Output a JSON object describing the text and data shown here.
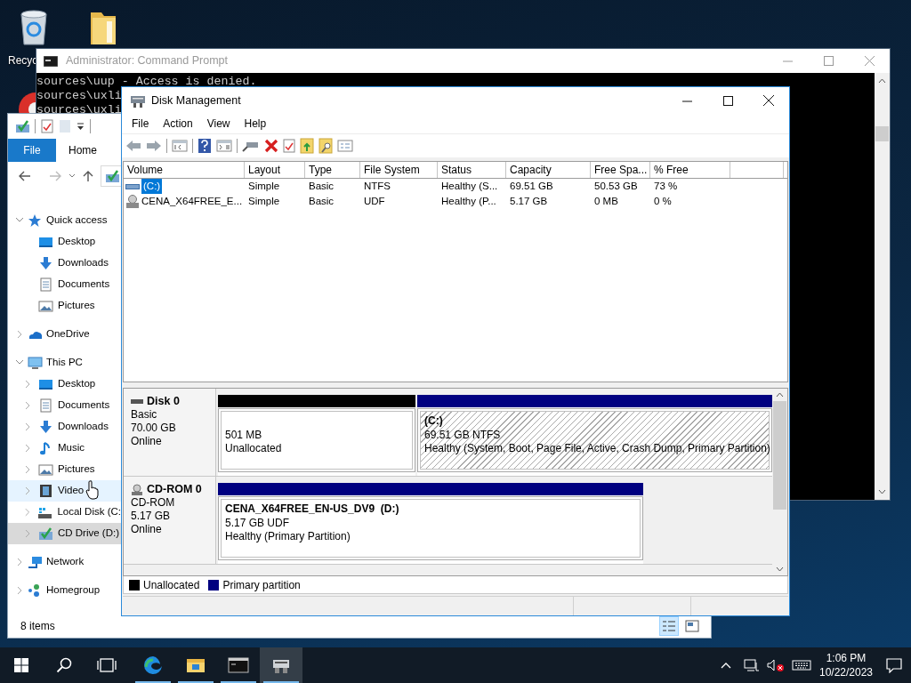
{
  "desktop_icons": [
    {
      "kind": "recycle_bin",
      "label": "Recyc"
    },
    {
      "kind": "folder"
    }
  ],
  "command_prompt": {
    "title": "Administrator: Command Prompt",
    "active": false,
    "lines": [
      "sources\\uup - Access is denied.",
      "sources\\uxli",
      "sources\\uxli"
    ]
  },
  "explorer": {
    "ribbon_tabs": [
      {
        "label": "File",
        "kind": "menu"
      },
      {
        "label": "Home",
        "kind": "tab"
      }
    ],
    "tree": [
      {
        "kind": "quick_access",
        "label": "Quick access",
        "expanded": true,
        "selected": false,
        "hover": false,
        "children": [
          {
            "kind": "desktop",
            "label": "Desktop",
            "selected": false,
            "hover": false
          },
          {
            "kind": "downloads",
            "label": "Downloads",
            "selected": false,
            "hover": false
          },
          {
            "kind": "documents",
            "label": "Documents",
            "selected": false,
            "hover": false
          },
          {
            "kind": "pictures",
            "label": "Pictures",
            "selected": false,
            "hover": false
          }
        ]
      },
      {
        "kind": "onedrive",
        "label": "OneDrive",
        "expanded": false,
        "selected": false,
        "hover": false
      },
      {
        "kind": "pc",
        "label": "This PC",
        "expanded": true,
        "selected": false,
        "hover": false,
        "children": [
          {
            "kind": "desktop",
            "label": "Desktop",
            "expanded": false,
            "selected": false,
            "hover": false
          },
          {
            "kind": "documents",
            "label": "Documents",
            "expanded": false,
            "selected": false,
            "hover": false
          },
          {
            "kind": "downloads",
            "label": "Downloads",
            "expanded": false,
            "selected": false,
            "hover": false
          },
          {
            "kind": "music",
            "label": "Music",
            "expanded": false,
            "selected": false,
            "hover": false
          },
          {
            "kind": "pictures",
            "label": "Pictures",
            "expanded": false,
            "selected": false,
            "hover": false
          },
          {
            "kind": "videos",
            "label": "Video",
            "expanded": false,
            "selected": false,
            "hover": true
          },
          {
            "kind": "local_disk",
            "label": "Local Disk (C:",
            "expanded": false,
            "selected": false,
            "hover": false
          },
          {
            "kind": "cd",
            "label": "CD Drive (D:)",
            "expanded": false,
            "selected": true,
            "hover": false
          }
        ]
      },
      {
        "kind": "network",
        "label": "Network",
        "expanded": false,
        "selected": false,
        "hover": false
      },
      {
        "kind": "homegroup",
        "label": "Homegroup",
        "expanded": false,
        "selected": false,
        "hover": false
      }
    ],
    "status": "8 items",
    "views": [
      {
        "kind": "details",
        "selected": true
      },
      {
        "kind": "tiles",
        "selected": false
      }
    ]
  },
  "disk_management": {
    "title": "Disk Management",
    "menu": [
      "File",
      "Action",
      "View",
      "Help"
    ],
    "table": {
      "columns": [
        "Volume",
        "Layout",
        "Type",
        "File System",
        "Status",
        "Capacity",
        "Free Spa...",
        "% Free"
      ],
      "rows": [
        {
          "kind": "hdd",
          "selected": true,
          "cells": [
            "(C:)",
            "Simple",
            "Basic",
            "NTFS",
            "Healthy (S...",
            "69.51 GB",
            "50.53 GB",
            "73 %"
          ]
        },
        {
          "kind": "cd",
          "selected": false,
          "cells": [
            "CENA_X64FREE_E...",
            "Simple",
            "Basic",
            "UDF",
            "Healthy (P...",
            "5.17 GB",
            "0 MB",
            "0 %"
          ]
        }
      ]
    },
    "disks": [
      {
        "kind": "hdd",
        "name": "Disk 0",
        "details": [
          "Basic",
          "70.00 GB",
          "Online"
        ],
        "partitions": [
          {
            "kind": "unallocated",
            "color": "#000000",
            "selected": false,
            "lines": [
              "501 MB",
              "Unallocated"
            ]
          },
          {
            "kind": "primary",
            "color": "#000080",
            "selected": true,
            "name": "(C:)",
            "lines": [
              "69.51 GB NTFS",
              "Healthy (System, Boot, Page File, Active, Crash Dump, Primary Partition)"
            ]
          }
        ]
      },
      {
        "kind": "cd",
        "name": "CD-ROM 0",
        "details": [
          "CD-ROM",
          "5.17 GB",
          "Online"
        ],
        "partitions": [
          {
            "kind": "primary",
            "color": "#000080",
            "selected": false,
            "name": "CENA_X64FREE_EN-US_DV9  (D:)",
            "lines": [
              "5.17 GB UDF",
              "Healthy (Primary Partition)"
            ]
          }
        ]
      }
    ],
    "legend": [
      {
        "label": "Unallocated",
        "color": "#000000"
      },
      {
        "label": "Primary partition",
        "color": "#000080"
      }
    ]
  },
  "taskbar": {
    "apps": [
      {
        "kind": "edge",
        "selected": false
      },
      {
        "kind": "explorer",
        "selected": false
      },
      {
        "kind": "cmd",
        "selected": false
      },
      {
        "kind": "disk_management",
        "selected": true
      }
    ],
    "time": "1:06 PM",
    "date": "10/22/2023"
  }
}
